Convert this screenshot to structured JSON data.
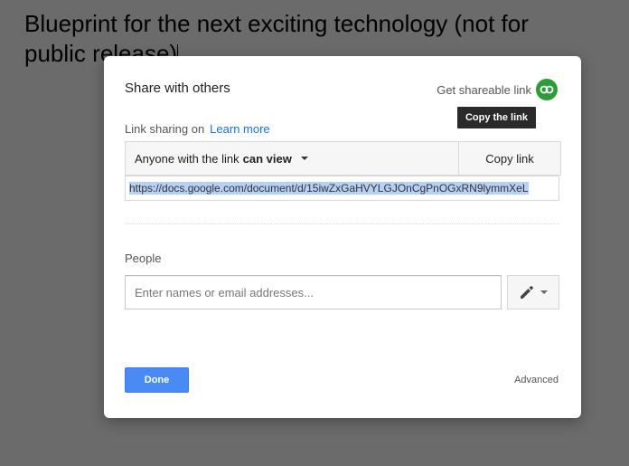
{
  "document": {
    "title_line1": "Blueprint for the next exciting technology (not for",
    "title_line2": "public release)"
  },
  "dialog": {
    "title": "Share with others",
    "shareable_label": "Get shareable link",
    "tooltip": "Copy the link",
    "sharing_status": "Link sharing on",
    "learn_more": "Learn more",
    "access_prefix": "Anyone with the link",
    "access_level": "can view",
    "copy_link": "Copy link",
    "url": "https://docs.google.com/document/d/15iwZxGaHVYLGJOnCgPnOGxRN9lymmXeL",
    "people_label": "People",
    "people_placeholder": "Enter names or email addresses...",
    "done": "Done",
    "advanced": "Advanced"
  },
  "colors": {
    "link_icon_bg": "#2e9b3a",
    "done_bg": "#4a8af4",
    "learn_more": "#1a73e8"
  }
}
